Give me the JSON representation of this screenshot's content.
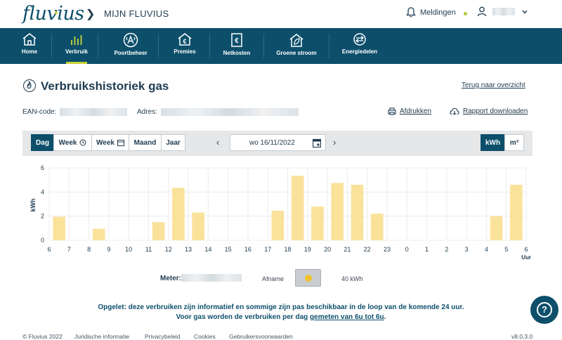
{
  "header": {
    "logo_text": "fluvius",
    "breadcrumb": "MIJN FLUVIUS",
    "notifications_label": "Meldingen"
  },
  "nav": {
    "items": [
      {
        "label": "Home",
        "icon": "house-icon"
      },
      {
        "label": "Verbruik",
        "icon": "bars-icon",
        "active": true
      },
      {
        "label": "Poortbeheer",
        "icon": "gateway-icon"
      },
      {
        "label": "Premies",
        "icon": "house-euro-icon"
      },
      {
        "label": "Netkosten",
        "icon": "euro-document-icon"
      },
      {
        "label": "Groene stroom",
        "icon": "green-house-icon"
      },
      {
        "label": "Energiedelen",
        "icon": "sharing-icon"
      }
    ],
    "accent_color": "#c9d33a",
    "bar_color": "#0d4f6b"
  },
  "page": {
    "title": "Verbruikshistoriek gas",
    "back_link": "Terug naar overzicht",
    "ean_label": "EAN-code:",
    "address_label": "Adres:",
    "print_label": "Afdrukken",
    "download_label": "Rapport downloaden"
  },
  "toolbar": {
    "period_buttons": [
      "Dag",
      "Week",
      "Week",
      "Maand",
      "Jaar"
    ],
    "active_period": "Dag",
    "date_value": "wo 16/11/2022",
    "unit_buttons": [
      "kWh",
      "m³"
    ],
    "active_unit": "kWh"
  },
  "chart_data": {
    "type": "bar",
    "categories": [
      "6",
      "7",
      "8",
      "9",
      "10",
      "11",
      "12",
      "13",
      "14",
      "15",
      "16",
      "17",
      "18",
      "19",
      "20",
      "21",
      "22",
      "23",
      "0",
      "1",
      "2",
      "3",
      "4",
      "5",
      "6"
    ],
    "x_tick_labels": [
      "6",
      "7",
      "8",
      "9",
      "10",
      "11",
      "12",
      "13",
      "14",
      "15",
      "16",
      "17",
      "18",
      "19",
      "20",
      "21",
      "22",
      "23",
      "0",
      "1",
      "2",
      "3",
      "4",
      "5",
      "6"
    ],
    "values": [
      1.95,
      0,
      0.95,
      0,
      0,
      1.5,
      4.35,
      2.3,
      0,
      0,
      0,
      2.45,
      5.35,
      2.8,
      4.75,
      4.6,
      2.2,
      0,
      0,
      0,
      0,
      0,
      2.0,
      4.6
    ],
    "ylabel": "kWh",
    "xlabel": "Uur",
    "ylim": [
      0,
      6
    ],
    "y_ticks": [
      "0",
      "2",
      "4",
      "6"
    ],
    "grid": true,
    "bar_color": "#fae29a"
  },
  "meter": {
    "label": "Meter:",
    "direction_label": "Afname",
    "legend_color": "#f2c12e",
    "total": "40 kWh"
  },
  "notice": {
    "line1": "Opgelet: deze verbruiken zijn informatief en sommige zijn pas beschikbaar in de loop van de komende 24 uur.",
    "line2_prefix": "Voor gas worden de verbruiken per dag ",
    "line2_link": "gemeten van 6u tot 6u",
    "line2_suffix": "."
  },
  "footer": {
    "copyright": "© Fluvius 2022",
    "links": [
      "Juridische informatie",
      "Privacybeleid",
      "Cookies",
      "Gebruikersvoorwaarden"
    ],
    "version": "v8.0.3.0"
  }
}
